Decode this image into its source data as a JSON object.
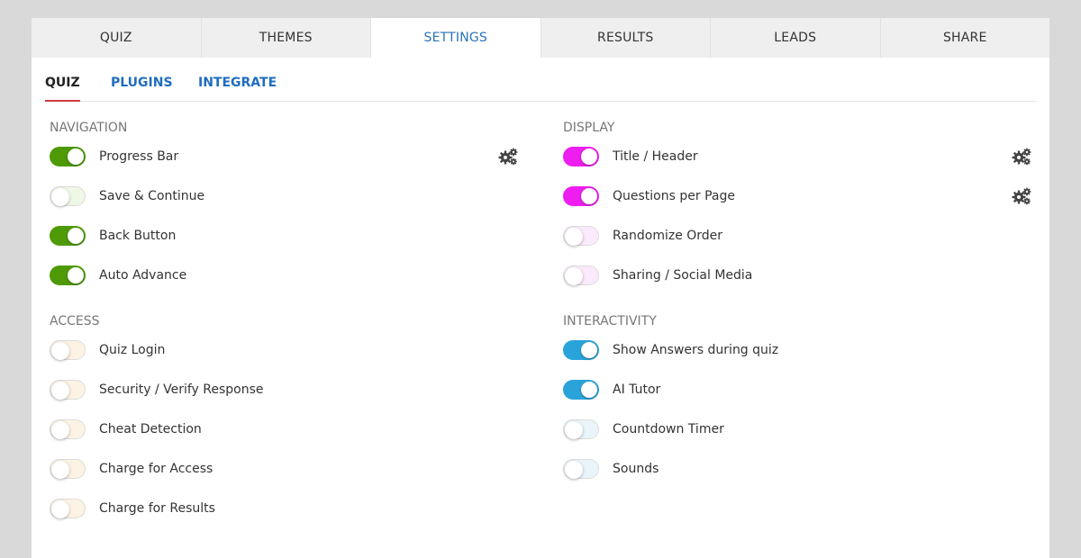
{
  "top_tabs": [
    {
      "label": "QUIZ",
      "active": false
    },
    {
      "label": "THEMES",
      "active": false
    },
    {
      "label": "SETTINGS",
      "active": true
    },
    {
      "label": "RESULTS",
      "active": false
    },
    {
      "label": "LEADS",
      "active": false
    },
    {
      "label": "SHARE",
      "active": false
    }
  ],
  "sub_tabs": [
    {
      "label": "QUIZ",
      "active": true
    },
    {
      "label": "PLUGINS",
      "active": false
    },
    {
      "label": "INTEGRATE",
      "active": false
    }
  ],
  "colors": {
    "navigation_on": "#4e9a06",
    "navigation_off_tint": "#eef8e6",
    "display_on": "#ee1ef0",
    "display_off_tint": "#fbeafb",
    "access_off_tint": "#fdf3e4",
    "interactivity_on": "#2aa3da",
    "interactivity_off_tint": "#e9f5fb"
  },
  "left": {
    "navigation": {
      "title": "NAVIGATION",
      "items": [
        {
          "label": "Progress Bar",
          "on": true,
          "settings_icon": "gears-icon"
        },
        {
          "label": "Save & Continue",
          "on": false
        },
        {
          "label": "Back Button",
          "on": true
        },
        {
          "label": "Auto Advance",
          "on": true
        }
      ]
    },
    "access": {
      "title": "ACCESS",
      "items": [
        {
          "label": "Quiz Login",
          "on": false
        },
        {
          "label": "Security / Verify Response",
          "on": false
        },
        {
          "label": "Cheat Detection",
          "on": false
        },
        {
          "label": "Charge for Access",
          "on": false
        },
        {
          "label": "Charge for Results",
          "on": false
        }
      ]
    }
  },
  "right": {
    "display": {
      "title": "DISPLAY",
      "items": [
        {
          "label": "Title / Header",
          "on": true,
          "settings_icon": "gears-icon"
        },
        {
          "label": "Questions per Page",
          "on": true,
          "settings_icon": "gears-icon"
        },
        {
          "label": "Randomize Order",
          "on": false
        },
        {
          "label": "Sharing / Social Media",
          "on": false
        }
      ]
    },
    "interactivity": {
      "title": "INTERACTIVITY",
      "items": [
        {
          "label": "Show Answers during quiz",
          "on": true
        },
        {
          "label": "AI Tutor",
          "on": true
        },
        {
          "label": "Countdown Timer",
          "on": false
        },
        {
          "label": "Sounds",
          "on": false
        }
      ]
    }
  }
}
